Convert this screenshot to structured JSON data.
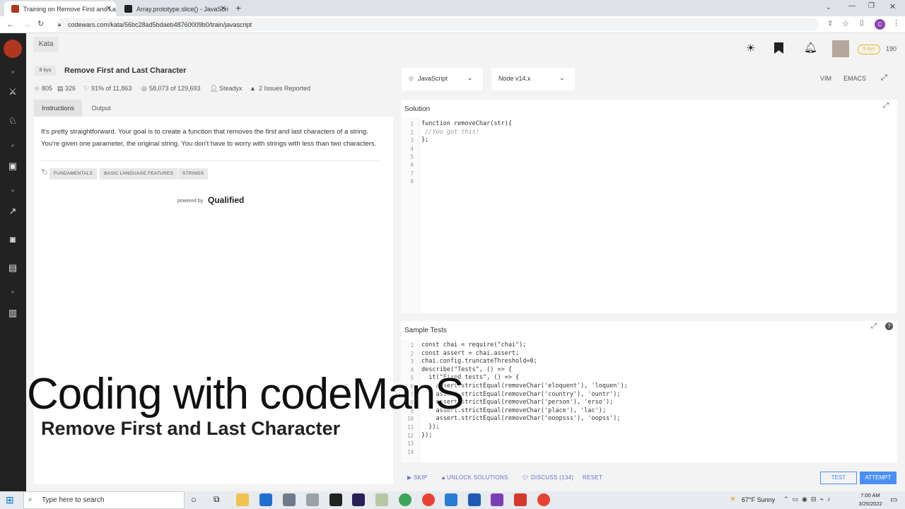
{
  "browser": {
    "tabs": [
      {
        "title": "Training on Remove First and La",
        "close": "✕"
      },
      {
        "title": "Array.prototype.slice() - JavaScri",
        "close": "✕"
      }
    ],
    "new_tab": "+",
    "url": "codewars.com/kata/56bc28ad5bdaeb48760009b0/train/javascript",
    "avatar_letter": "C"
  },
  "header": {
    "kata_tab": "Kata",
    "rank_badge": "6 kyu",
    "honor": "190"
  },
  "kata": {
    "rank": "8 kyu",
    "title": "Remove First and Last Character",
    "stars": "805",
    "collections": "326",
    "satisfaction": "91% of 11,863",
    "completions": "58,073 of 129,693",
    "author": "Steadyx",
    "issues": "2 Issues Reported",
    "tabs": [
      "Instructions",
      "Output"
    ],
    "description": "It's pretty straightforward. Your goal is to create a function that removes the first and last characters of a string. You're given one parameter, the original string. You don't have to worry with strings with less than two characters.",
    "tags": [
      "FUNDAMENTALS",
      "BASIC LANGUAGE FEATURES",
      "STRINGS"
    ],
    "powered_by": "powered by",
    "qualified": "Qualified"
  },
  "editor": {
    "language": "JavaScript",
    "runtime": "Node v14.x",
    "vim": "VIM",
    "emacs": "EMACS",
    "solution_title": "Solution",
    "solution_lines": [
      "function removeChar(str){",
      " //You got this!",
      "",
      "};",
      "",
      "",
      "",
      ""
    ],
    "tests_title": "Sample Tests",
    "tests_lines": [
      "const chai = require(\"chai\");",
      "const assert = chai.assert;",
      "chai.config.truncateThreshold=0;",
      "",
      "describe(\"Tests\", () => {",
      "  it(\"Fixed tests\", () => {",
      "    assert.strictEqual(removeChar('eloquent'), 'loquen');",
      "    assert.strictEqual(removeChar('country'), 'ountr');",
      "    assert.strictEqual(removeChar('person'), 'erso');",
      "    assert.strictEqual(removeChar('place'), 'lac');",
      "    assert.strictEqual(removeChar('ooopsss'), 'oopss');",
      "  });",
      "});",
      ""
    ]
  },
  "actions": {
    "skip": "SKIP",
    "unlock": "UNLOCK SOLUTIONS",
    "discuss": "DISCUSS (134)",
    "reset": "RESET",
    "test": "TEST",
    "attempt": "ATTEMPT"
  },
  "overlay": {
    "channel": "Coding with codeManS",
    "subtitle": "Remove First and Last Character"
  },
  "taskbar": {
    "search": "Type here to search",
    "weather": "67°F  Sunny",
    "time": "7:00 AM",
    "date": "3/25/2022"
  },
  "colors": {
    "accent": "#b1361e",
    "blue": "#4a8ff5",
    "link": "#6a6fc7"
  }
}
